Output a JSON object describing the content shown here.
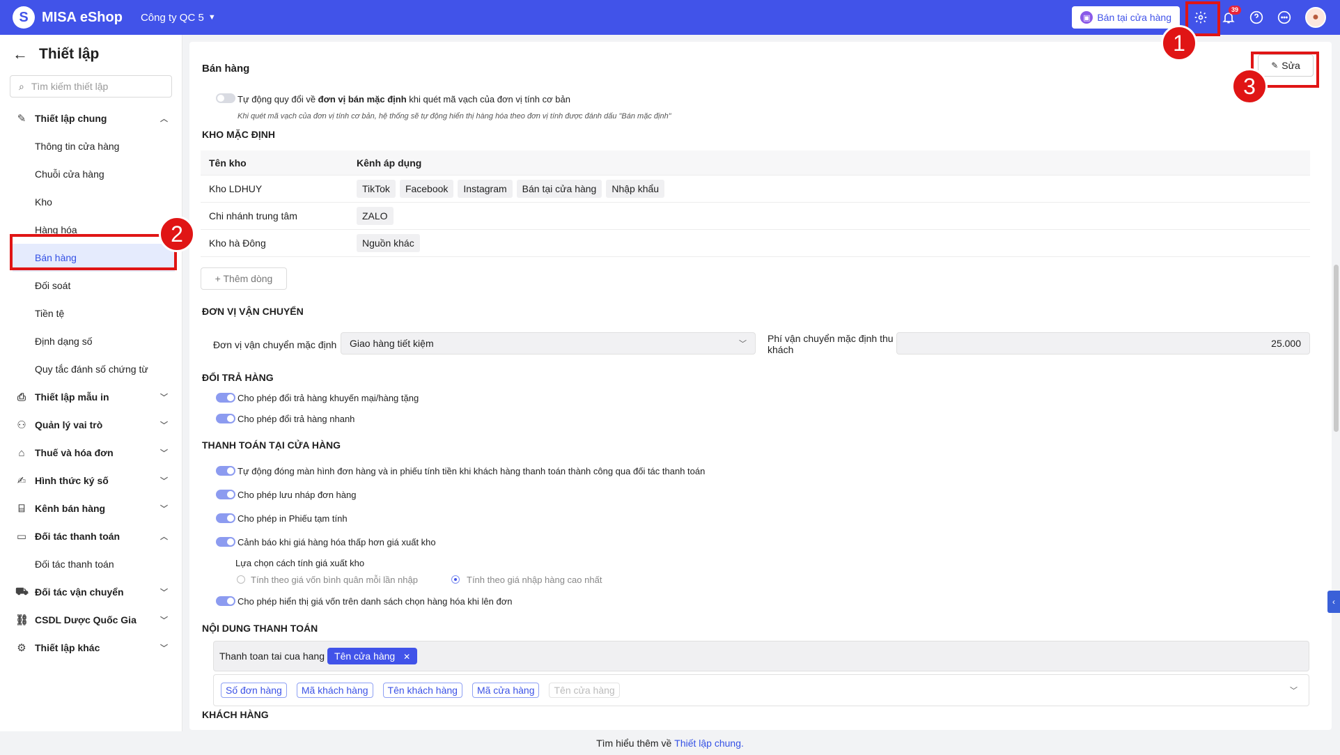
{
  "topbar": {
    "logo_mark": "S",
    "app_name": "MISA eShop",
    "company": "Công ty QC 5",
    "store_button": "Bán tại cửa hàng",
    "notification_count": "39"
  },
  "annotations": {
    "n1": "1",
    "n2": "2",
    "n3": "3"
  },
  "sidebar": {
    "title": "Thiết lập",
    "search_placeholder": "Tìm kiếm thiết lập",
    "group_general": "Thiết lập chung",
    "items": [
      "Thông tin cửa hàng",
      "Chuỗi cửa hàng",
      "Kho",
      "Hàng hóa",
      "Bán hàng",
      "Đối soát",
      "Tiền tệ",
      "Định dạng số",
      "Quy tắc đánh số chứng từ"
    ],
    "groups": [
      "Thiết lập mẫu in",
      "Quản lý vai trò",
      "Thuế và hóa đơn",
      "Hình thức ký số",
      "Kênh bán hàng",
      "Đối tác thanh toán"
    ],
    "payment_partner_item": "Đối tác thanh toán",
    "groups2": [
      "Đối tác vận chuyển",
      "CSDL Dược Quốc Gia",
      "Thiết lập khác"
    ]
  },
  "main": {
    "title": "Bán hàng",
    "edit_button": "Sửa",
    "auto_convert": {
      "prefix": "Tự động quy đổi về ",
      "bold": "đơn vị bán mặc định",
      "suffix": " khi quét mã vạch của đơn vị tính cơ bản",
      "note": "Khi quét mã vạch của đơn vị tính cơ bản, hệ thống sẽ tự động hiển thị hàng hóa theo đơn vị tính được đánh dấu \"Bán mặc định\""
    },
    "default_warehouse": {
      "title": "KHO MẶC ĐỊNH",
      "col_name": "Tên kho",
      "col_channels": "Kênh áp dụng",
      "rows": [
        {
          "name": "Kho LDHUY",
          "channels": [
            "TikTok",
            "Facebook",
            "Instagram",
            "Bán tại cửa hàng",
            "Nhập khẩu"
          ]
        },
        {
          "name": "Chi nhánh trung tâm",
          "channels": [
            "ZALO"
          ]
        },
        {
          "name": "Kho hà Đông",
          "channels": [
            "Nguồn khác"
          ]
        }
      ],
      "add_row": "+ Thêm dòng"
    },
    "shipping": {
      "title": "ĐƠN VỊ VẬN CHUYỂN",
      "default_label": "Đơn vị vận chuyển mặc định",
      "default_value": "Giao hàng tiết kiệm",
      "fee_label": "Phí vận chuyển mặc định thu khách",
      "fee_value": "25.000"
    },
    "returns": {
      "title": "ĐỔI TRẢ HÀNG",
      "opt1": "Cho phép đổi trả hàng khuyến mại/hàng tặng",
      "opt2": "Cho phép đổi trả hàng nhanh"
    },
    "store_payment": {
      "title": "THANH TOÁN TẠI CỬA HÀNG",
      "opt1": "Tự động đóng màn hình đơn hàng và in phiếu tính tiền khi khách hàng thanh toán thành công qua đối tác thanh toán",
      "opt2": "Cho phép lưu nháp đơn hàng",
      "opt3": "Cho phép in Phiếu tạm tính",
      "opt4": "Cảnh báo khi giá hàng hóa thấp hơn giá xuất kho",
      "method_label": "Lựa chọn cách tính giá xuất kho",
      "radio1": "Tính theo giá vốn bình quân mỗi lần nhập",
      "radio2": "Tính theo giá nhập hàng cao nhất",
      "opt5": "Cho phép hiển thị giá vốn trên danh sách chọn hàng hóa khi lên đơn"
    },
    "payment_content": {
      "title": "NỘI DUNG THANH TOÁN",
      "prefix_text": "Thanh toan tai cua hang",
      "selected_tag": "Tên cửa hàng",
      "options": [
        "Số đơn hàng",
        "Mã khách hàng",
        "Tên khách hàng",
        "Mã cửa hàng"
      ],
      "disabled_option": "Tên cửa hàng"
    },
    "customers": {
      "title": "KHÁCH HÀNG"
    }
  },
  "footer": {
    "text": "Tìm hiểu thêm về",
    "link": "Thiết lập chung."
  },
  "colors": {
    "brand": "#4153e9",
    "annotation_red": "#e01515",
    "active_bg": "#e5ebfd"
  }
}
